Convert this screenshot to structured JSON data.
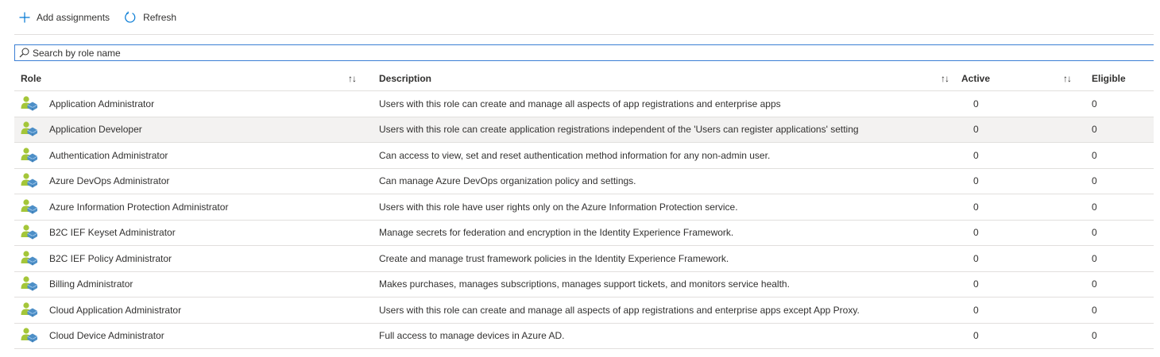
{
  "toolbar": {
    "add_label": "Add assignments",
    "refresh_label": "Refresh"
  },
  "search": {
    "placeholder": "Search by role name",
    "value": ""
  },
  "table": {
    "headers": {
      "role": "Role",
      "description": "Description",
      "active": "Active",
      "eligible": "Eligible",
      "sort_glyph": "↑↓"
    },
    "rows": [
      {
        "role": "Application Administrator",
        "description": "Users with this role can create and manage all aspects of app registrations and enterprise apps",
        "active": "0",
        "eligible": "0"
      },
      {
        "role": "Application Developer",
        "description": "Users with this role can create application registrations independent of the 'Users can register applications' setting",
        "active": "0",
        "eligible": "0"
      },
      {
        "role": "Authentication Administrator",
        "description": "Can access to view, set and reset authentication method information for any non-admin user.",
        "active": "0",
        "eligible": "0"
      },
      {
        "role": "Azure DevOps Administrator",
        "description": "Can manage Azure DevOps organization policy and settings.",
        "active": "0",
        "eligible": "0"
      },
      {
        "role": "Azure Information Protection Administrator",
        "description": "Users with this role have user rights only on the Azure Information Protection service.",
        "active": "0",
        "eligible": "0"
      },
      {
        "role": "B2C IEF Keyset Administrator",
        "description": "Manage secrets for federation and encryption in the Identity Experience Framework.",
        "active": "0",
        "eligible": "0"
      },
      {
        "role": "B2C IEF Policy Administrator",
        "description": "Create and manage trust framework policies in the Identity Experience Framework.",
        "active": "0",
        "eligible": "0"
      },
      {
        "role": "Billing Administrator",
        "description": "Makes purchases, manages subscriptions, manages support tickets, and monitors service health.",
        "active": "0",
        "eligible": "0"
      },
      {
        "role": "Cloud Application Administrator",
        "description": "Users with this role can create and manage all aspects of app registrations and enterprise apps except App Proxy.",
        "active": "0",
        "eligible": "0"
      },
      {
        "role": "Cloud Device Administrator",
        "description": "Full access to manage devices in Azure AD.",
        "active": "0",
        "eligible": "0"
      }
    ],
    "selected_row_index": 1
  },
  "colors": {
    "accent": "#0078d4",
    "selected_row": "#f3f2f1",
    "icon_person": "#a4c639",
    "icon_badge": "#4d8fc7"
  },
  "icons": {
    "add": "plus-icon",
    "refresh": "refresh-icon",
    "search": "search-icon",
    "role": "role-user-icon"
  }
}
